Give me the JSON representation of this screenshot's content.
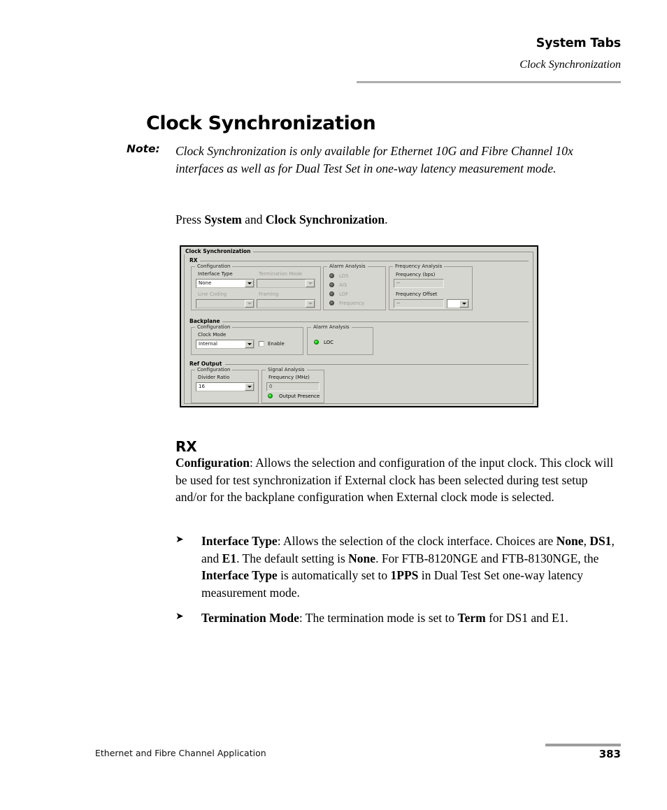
{
  "header": {
    "title": "System Tabs",
    "subtitle": "Clock Synchronization"
  },
  "doc_title": "Clock Synchronization",
  "note": {
    "label": "Note:",
    "text": "Clock Synchronization is only available for Ethernet 10G and Fibre Channel 10x interfaces as well as for Dual Test Set in one-way latency measurement mode."
  },
  "press_instruction": {
    "prefix": "Press ",
    "bold1": "System",
    "middle": " and ",
    "bold2": "Clock Synchronization",
    "suffix": "."
  },
  "app_screenshot": {
    "dialog_title": "Clock Synchronization",
    "rx": {
      "section_label": "RX",
      "configuration": {
        "group_label": "Configuration",
        "interface_type_label": "Interface Type",
        "interface_type_value": "None",
        "termination_mode_label": "Termination Mode",
        "termination_mode_value": "",
        "line_coding_label": "Line Coding",
        "line_coding_value": "",
        "framing_label": "Framing",
        "framing_value": ""
      },
      "alarm_analysis": {
        "group_label": "Alarm Analysis",
        "leds": [
          {
            "label": "LOS",
            "state": "off"
          },
          {
            "label": "AIS",
            "state": "off"
          },
          {
            "label": "LOF",
            "state": "off"
          },
          {
            "label": "Frequency",
            "state": "off"
          }
        ]
      },
      "frequency_analysis": {
        "group_label": "Frequency Analysis",
        "frequency_label": "Frequency (bps)",
        "frequency_value": "--",
        "offset_label": "Frequency Offset",
        "offset_value": "--",
        "offset_unit_value": ""
      }
    },
    "backplane": {
      "section_label": "Backplane",
      "configuration": {
        "group_label": "Configuration",
        "clock_mode_label": "Clock Mode",
        "clock_mode_value": "Internal",
        "enable_label": "Enable",
        "enable_checked": false
      },
      "alarm_analysis": {
        "group_label": "Alarm Analysis",
        "leds": [
          {
            "label": "LOC",
            "state": "on"
          }
        ]
      }
    },
    "ref_output": {
      "section_label": "Ref Output",
      "configuration": {
        "group_label": "Configuration",
        "divider_ratio_label": "Divider Ratio",
        "divider_ratio_value": "16"
      },
      "signal_analysis": {
        "group_label": "Signal Analysis",
        "frequency_label": "Frequency (MHz)",
        "frequency_value": "0",
        "output_presence_label": "Output Presence",
        "output_presence_state": "on"
      }
    },
    "colors": {
      "dialog_background": "#d6d6d0",
      "led_on": "#14cc12",
      "led_off": "#5d5d57",
      "field_background": "#ffffff"
    }
  },
  "rx_section": {
    "heading": "RX",
    "configuration_paragraph": {
      "term": "Configuration",
      "text": ": Allows the selection and configuration of the input clock. This clock will be used for test synchronization if External clock has been selected during test setup and/or for the backplane configuration when External clock mode is selected."
    },
    "bullets": [
      {
        "glyph": "➤",
        "term": "Interface Type",
        "text_parts": [
          ": Allows the selection of the clock interface. Choices are ",
          "None",
          ", ",
          "DS1",
          ", and ",
          "E1",
          ". The default setting is ",
          "None",
          ". For FTB-8120NGE and FTB-8130NGE, the ",
          "Interface Type",
          " is automatically set to ",
          "1PPS",
          " in Dual Test Set one-way latency measurement mode."
        ]
      },
      {
        "glyph": "➤",
        "term": "Termination Mode",
        "text_parts": [
          ": The termination mode is set to ",
          "Term",
          " for DS1 and E1."
        ]
      }
    ]
  },
  "footer": {
    "document_name": "Ethernet and Fibre Channel Application",
    "page_number": "383"
  }
}
